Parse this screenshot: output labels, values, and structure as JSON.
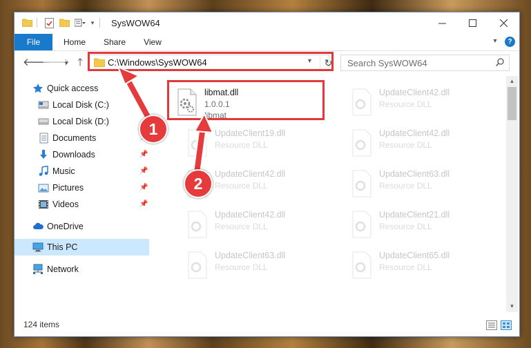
{
  "window": {
    "title": "SysWOW64"
  },
  "ribbon": {
    "tabs": [
      "File",
      "Home",
      "Share",
      "View"
    ]
  },
  "address": {
    "path": "C:\\Windows\\SysWOW64"
  },
  "search": {
    "placeholder": "Search SysWOW64"
  },
  "sidebar": {
    "items": [
      {
        "label": "Quick access",
        "icon": "star-icon"
      },
      {
        "label": "Local Disk (C:)",
        "icon": "drive-icon"
      },
      {
        "label": "Local Disk (D:)",
        "icon": "drive-icon"
      },
      {
        "label": "Documents",
        "icon": "documents-icon"
      },
      {
        "label": "Downloads",
        "icon": "download-icon"
      },
      {
        "label": "Music",
        "icon": "music-icon"
      },
      {
        "label": "Pictures",
        "icon": "pictures-icon"
      },
      {
        "label": "Videos",
        "icon": "videos-icon"
      },
      {
        "label": "OneDrive",
        "icon": "cloud-icon"
      },
      {
        "label": "This PC",
        "icon": "computer-icon"
      },
      {
        "label": "Network",
        "icon": "network-icon"
      }
    ],
    "selected": "This PC"
  },
  "files": {
    "highlighted": {
      "name": "libmat.dll",
      "version": "1.0.0.1",
      "description": "libmat"
    },
    "faded": [
      {
        "name": "UpdateClient42.dll",
        "type": "Resource DLL"
      },
      {
        "name": "UpdateClient19.dll",
        "type": "Resource DLL"
      },
      {
        "name": "UpdateClient42.dll",
        "type": "Resource DLL"
      },
      {
        "name": "UpdateClient42.dll",
        "type": "Resource DLL"
      },
      {
        "name": "UpdateClient63.dll",
        "type": "Resource DLL"
      },
      {
        "name": "UpdateClient42.dll",
        "type": "Resource DLL"
      },
      {
        "name": "UpdateClient21.dll",
        "type": "Resource DLL"
      },
      {
        "name": "UpdateClient63.dll",
        "type": "Resource DLL"
      },
      {
        "name": "UpdateClient65.dll",
        "type": "Resource DLL"
      }
    ]
  },
  "status": {
    "item_count": "124 items"
  },
  "callouts": [
    "1",
    "2"
  ],
  "colors": {
    "accent": "#1979ca",
    "highlight": "#e4373a",
    "selected": "#cce8ff"
  }
}
